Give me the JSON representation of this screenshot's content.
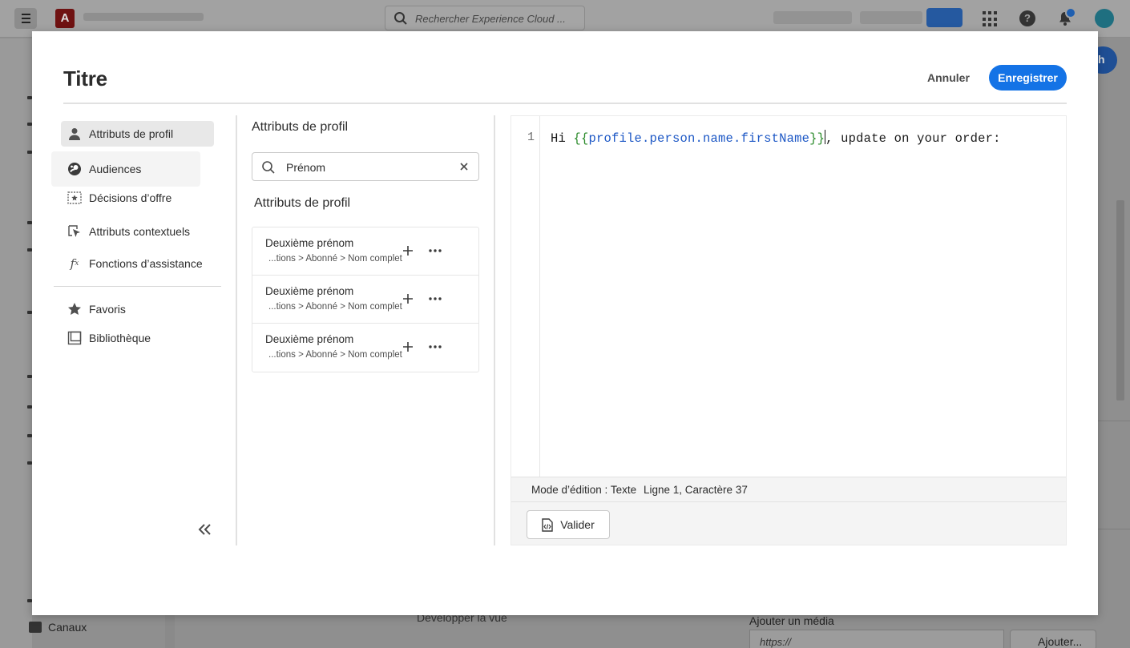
{
  "background": {
    "search_placeholder": "Rechercher Experience Cloud ...",
    "channels_label": "Canaux",
    "expand_view_label": "Développer la vue",
    "add_media_label": "Ajouter un média",
    "url_placeholder": "https://",
    "add_button_label": "Ajouter...",
    "right_button_label": "h"
  },
  "modal": {
    "title": "Titre",
    "cancel_label": "Annuler",
    "save_label": "Enregistrer"
  },
  "nav": {
    "items": [
      {
        "label": "Attributs de profil",
        "icon": "user-icon"
      },
      {
        "label": "Audiences",
        "icon": "audience-icon"
      },
      {
        "label": "Décisions d’offre",
        "icon": "offer-decision-icon"
      },
      {
        "label": "Attributs contextuels",
        "icon": "cursor-select-icon"
      },
      {
        "label": "Fonctions d’assistance",
        "icon": "function-icon"
      }
    ],
    "secondary": [
      {
        "label": "Favoris",
        "icon": "star-icon"
      },
      {
        "label": "Bibliothèque",
        "icon": "library-icon"
      }
    ],
    "collapse_icon": "double-chevron-left-icon"
  },
  "middle": {
    "heading": "Attributs de profil",
    "search_value": "Prénom",
    "results_heading": "Attributs de profil",
    "items": [
      {
        "name": "Deuxième prénom",
        "path": "...tions > Abonné > Nom complet"
      },
      {
        "name": "Deuxième prénom",
        "path": "...tions > Abonné > Nom complet"
      },
      {
        "name": "Deuxième prénom",
        "path": "...tions > Abonné > Nom complet"
      }
    ]
  },
  "editor": {
    "line_number": "1",
    "code_prefix": "Hi ",
    "open_brace": "{{",
    "expression": "profile.person.name.firstName",
    "close_brace": "}}",
    "code_suffix": ", update on your order:",
    "status_mode": "Mode d’édition : Texte",
    "status_position": "Ligne 1, Caractère 37",
    "validate_label": "Valider"
  },
  "colors": {
    "accent": "#1473e6",
    "code_brace": "#2a8a2a",
    "code_variable": "#1c57c5"
  }
}
